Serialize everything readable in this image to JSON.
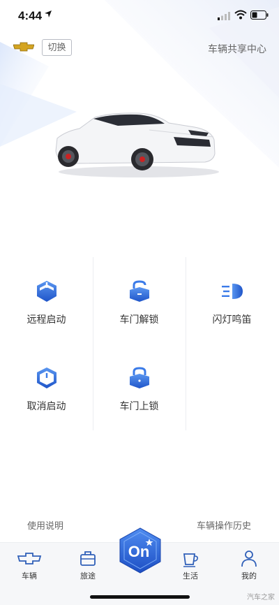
{
  "status_bar": {
    "time": "4:44"
  },
  "header": {
    "switch_label": "切换",
    "share_center_label": "车辆共享中心"
  },
  "colors": {
    "accent": "#3b7be8",
    "accent_dark": "#1f55c9",
    "text": "#333333",
    "muted": "#666666"
  },
  "controls": [
    {
      "label": "远程启动",
      "icon": "shield-power-icon"
    },
    {
      "label": "车门解锁",
      "icon": "unlock-icon"
    },
    {
      "label": "闪灯鸣笛",
      "icon": "headlight-icon"
    },
    {
      "label": "取消启动",
      "icon": "shield-cancel-icon"
    },
    {
      "label": "车门上锁",
      "icon": "lock-icon"
    }
  ],
  "links": {
    "instructions": "使用说明",
    "history": "车辆操作历史"
  },
  "tabbar": {
    "tabs": [
      {
        "label": "车辆",
        "icon": "car-brand-icon"
      },
      {
        "label": "旅途",
        "icon": "briefcase-icon"
      },
      {
        "label": "生活",
        "icon": "cup-icon"
      },
      {
        "label": "我的",
        "icon": "person-icon"
      }
    ],
    "center_button": "On"
  },
  "watermark": "汽车之家"
}
